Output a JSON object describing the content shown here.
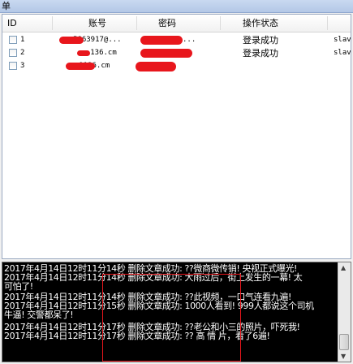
{
  "window": {
    "title": "单"
  },
  "table": {
    "columns": [
      "ID",
      "账号",
      "密码",
      "操作状态"
    ],
    "rows": [
      {
        "id": "1",
        "account": "5863917@...",
        "password": "...",
        "status": "登录成功",
        "extra": "slav"
      },
      {
        "id": "2",
        "account": "...136.cm",
        "password": "",
        "status": "登录成功",
        "extra": "slav"
      },
      {
        "id": "3",
        "account": "...9136.cm",
        "password": "",
        "status": "",
        "extra": ""
      }
    ]
  },
  "log": {
    "lines": [
      "2017年4月14日12时11分14秒 删除文章成功: ??微商微传销! 央视正式曝光!",
      "2017年4月14日12时11分14秒 删除文章成功: 大雨过后，街上发生的一幕! 太",
      "可怕了!",
      "2017年4月14日12时11分14秒 删除文章成功: ??此视频，一口气连看九遍!",
      "2017年4月14日12时11分15秒 删除文章成功: 1000人看到! 999人都说这个司机",
      "牛逼! 交警都呆了!",
      "2017年4月14日12时11分17秒 删除文章成功: ??老公和小三的照片，吓死我!",
      "2017年4月14日12时11分17秒 删除文章成功: ?? 高 情 片，看了6遍!"
    ]
  }
}
